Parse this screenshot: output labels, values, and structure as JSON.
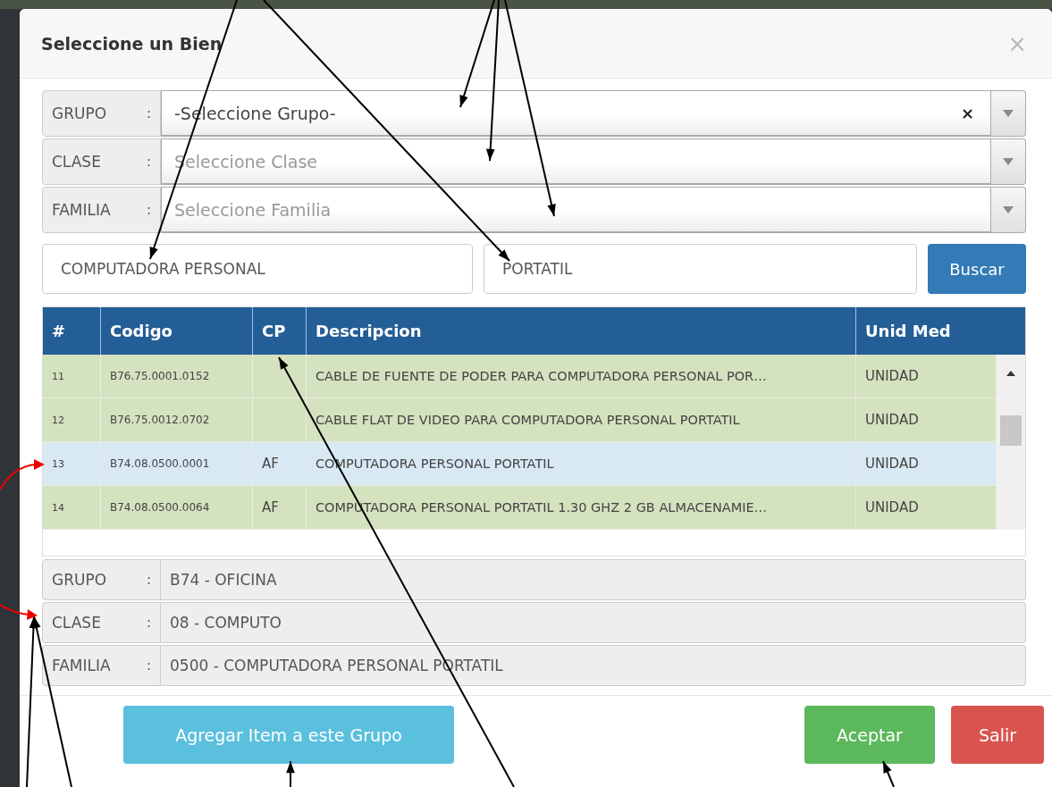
{
  "dialog": {
    "title": "Seleccione un Bien",
    "close": "×"
  },
  "filters": [
    {
      "label": "GRUPO",
      "separator": ":",
      "value": "-Seleccione Grupo-",
      "clear": "×"
    },
    {
      "label": "CLASE",
      "separator": ":",
      "placeholder": "Seleccione Clase"
    },
    {
      "label": "FAMILIA",
      "separator": ":",
      "placeholder": "Seleccione Familia"
    }
  ],
  "search": {
    "fields": [
      "COMPUTADORA PERSONAL",
      "PORTATIL"
    ],
    "button": "Buscar"
  },
  "table": {
    "columns": [
      "#",
      "Codigo",
      "CP",
      "Descripcion",
      "Unid Med"
    ],
    "rows": [
      {
        "cells": [
          "11",
          "B76.75.0001.0152",
          "",
          "CABLE DE FUENTE DE PODER PARA COMPUTADORA PERSONAL POR…",
          "UNIDAD"
        ],
        "selected": false
      },
      {
        "cells": [
          "12",
          "B76.75.0012.0702",
          "",
          "CABLE FLAT DE VIDEO PARA COMPUTADORA PERSONAL PORTATIL",
          "UNIDAD"
        ],
        "selected": false
      },
      {
        "cells": [
          "13",
          "B74.08.0500.0001",
          "AF",
          "COMPUTADORA PERSONAL PORTATIL",
          "UNIDAD"
        ],
        "selected": true
      },
      {
        "cells": [
          "14",
          "B74.08.0500.0064",
          "AF",
          "COMPUTADORA PERSONAL PORTATIL 1.30 GHZ 2 GB ALMACENAMIE…",
          "UNIDAD"
        ],
        "selected": false
      }
    ]
  },
  "details": [
    {
      "label": "GRUPO",
      "separator": ":",
      "value": "B74 - OFICINA"
    },
    {
      "label": "CLASE",
      "separator": ":",
      "value": "08 - COMPUTO"
    },
    {
      "label": "FAMILIA",
      "separator": ":",
      "value": "0500 - COMPUTADORA PERSONAL PORTATIL"
    }
  ],
  "buttons": [
    {
      "label": "Agregar Item a este Grupo",
      "kind": "info"
    },
    {
      "label": "Aceptar",
      "kind": "success"
    },
    {
      "label": "Salir",
      "kind": "danger"
    }
  ]
}
